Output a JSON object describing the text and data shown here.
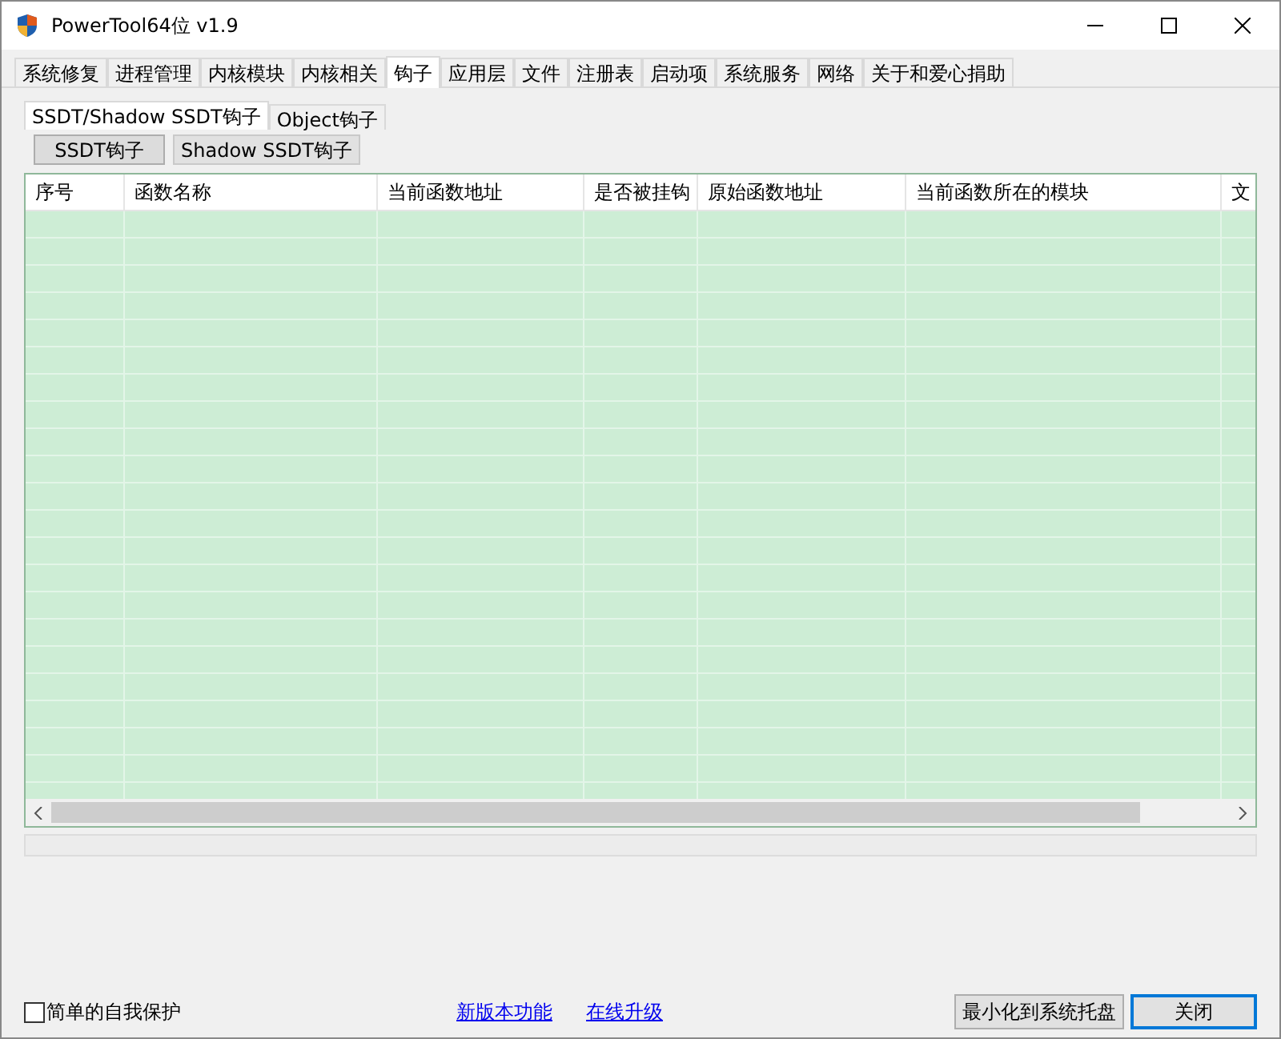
{
  "window": {
    "title": "PowerTool64位 v1.9"
  },
  "tabs": [
    {
      "label": "系统修复",
      "selected": false
    },
    {
      "label": "进程管理",
      "selected": false
    },
    {
      "label": "内核模块",
      "selected": false
    },
    {
      "label": "内核相关",
      "selected": false
    },
    {
      "label": "钩子",
      "selected": true
    },
    {
      "label": "应用层",
      "selected": false
    },
    {
      "label": "文件",
      "selected": false
    },
    {
      "label": "注册表",
      "selected": false
    },
    {
      "label": "启动项",
      "selected": false
    },
    {
      "label": "系统服务",
      "selected": false
    },
    {
      "label": "网络",
      "selected": false
    },
    {
      "label": "关于和爱心捐助",
      "selected": false
    }
  ],
  "subtabs": [
    {
      "label": "SSDT/Shadow SSDT钩子",
      "selected": true
    },
    {
      "label": "Object钩子",
      "selected": false
    }
  ],
  "hook_buttons": [
    {
      "label": "SSDT钩子",
      "selected": true
    },
    {
      "label": "Shadow SSDT钩子",
      "selected": false
    }
  ],
  "table": {
    "columns": [
      "序号",
      "函数名称",
      "当前函数地址",
      "是否被挂钩",
      "原始函数地址",
      "当前函数所在的模块",
      "文"
    ]
  },
  "footer": {
    "checkbox": {
      "label": "简单的自我保护",
      "checked": false
    },
    "links": [
      "新版本功能",
      "在线升级"
    ],
    "buttons": [
      "最小化到系统托盘",
      "关闭"
    ]
  }
}
